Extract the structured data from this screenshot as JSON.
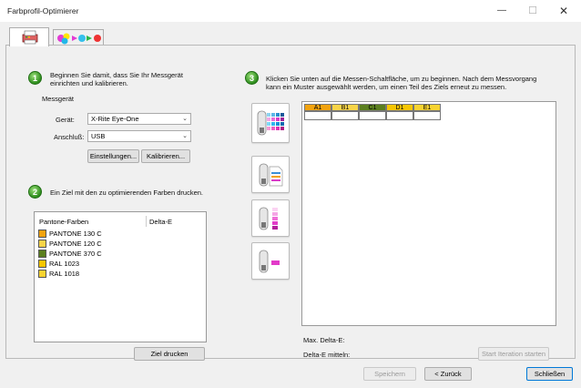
{
  "window": {
    "title": "Farbprofil-Optimierer",
    "minimize_symbol": "—",
    "maximize_symbol": "☐",
    "close_symbol": "✕"
  },
  "tabs": [
    {
      "icon": "printer-icon",
      "active": true
    },
    {
      "icon": "color-drops-arrows-icon",
      "active": false
    }
  ],
  "step1": {
    "number": "1",
    "text_line1": "Beginnen Sie damit, dass Sie Ihr Messgerät",
    "text_line2": "einrichten und kalibrieren.",
    "group_label": "Messgerät",
    "device_label": "Gerät:",
    "device_value": "X-Rite Eye-One",
    "connection_label": "Anschluß:",
    "connection_value": "USB",
    "settings_button": "Einstellungen...",
    "calibrate_button": "Kalibrieren..."
  },
  "step2": {
    "number": "2",
    "text": "Ein Ziel mit den zu optimierenden Farben drucken.",
    "list_header_name": "Pantone-Farben",
    "list_header_delta": "Delta-E",
    "items": [
      {
        "label": "PANTONE 130 C",
        "color": "#f2a30f"
      },
      {
        "label": "PANTONE 120 C",
        "color": "#f8d448"
      },
      {
        "label": "PANTONE 370 C",
        "color": "#5b7f1f"
      },
      {
        "label": "RAL 1023",
        "color": "#f7c600"
      },
      {
        "label": "RAL 1018",
        "color": "#f8d330"
      }
    ],
    "print_button": "Ziel drucken"
  },
  "step3": {
    "number": "3",
    "text_line1": "Klicken Sie unten auf die Messen-Schaltfläche, um zu beginnen. Nach dem Messvorgang",
    "text_line2": "kann ein Muster ausgewählt werden, um einen Teil des Ziels erneut zu messen.",
    "columns": [
      {
        "label": "A1",
        "color": "#f2a30f"
      },
      {
        "label": "B1",
        "color": "#f8d448"
      },
      {
        "label": "C1",
        "color": "#5b7f1f"
      },
      {
        "label": "D1",
        "color": "#f7c600"
      },
      {
        "label": "E1",
        "color": "#f8d330"
      }
    ],
    "max_delta_label": "Max. Delta-E:",
    "avg_delta_label": "Delta-E mitteln:",
    "start_iteration_button": "Start Iteration starten"
  },
  "measure_buttons": [
    {
      "icon": "measure-chart-icon"
    },
    {
      "icon": "measure-document-icon"
    },
    {
      "icon": "measure-strip-icon"
    },
    {
      "icon": "measure-spot-icon"
    }
  ],
  "footer": {
    "save_button": "Speichern",
    "back_button": "< Zurück",
    "close_button": "Schließen"
  }
}
